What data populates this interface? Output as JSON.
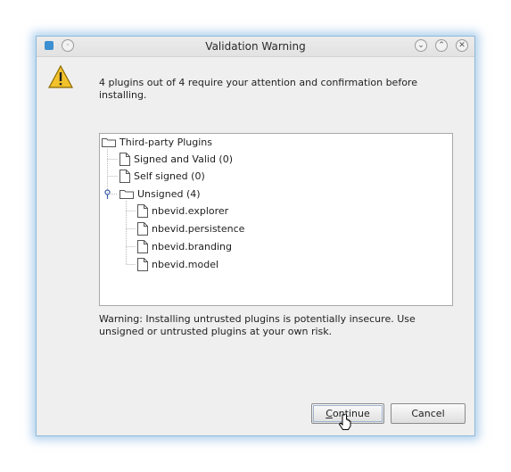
{
  "window": {
    "title": "Validation Warning",
    "icons": [
      "app-icon",
      "menu-dot-icon",
      "minimize-icon",
      "maximize-icon",
      "close-icon"
    ]
  },
  "message": "4 plugins out of 4 require your attention and confirmation before installing.",
  "tree": {
    "root": "Third-party Plugins",
    "categories": [
      {
        "label": "Signed and Valid (0)"
      },
      {
        "label": "Self signed (0)"
      },
      {
        "label": "Unsigned (4)"
      }
    ],
    "unsigned_children": [
      "nbevid.explorer",
      "nbevid.persistence",
      "nbevid.branding",
      "nbevid.model"
    ]
  },
  "warning": "Warning: Installing untrusted plugins is potentially insecure. Use unsigned or untrusted plugins at your own risk.",
  "buttons": {
    "continue_mnemonic": "C",
    "continue_rest": "ontinue",
    "cancel": "Cancel"
  },
  "colors": {
    "window_bg": "#efefef",
    "glow": "#6eaadc",
    "warning_yellow": "#f2c22a"
  }
}
